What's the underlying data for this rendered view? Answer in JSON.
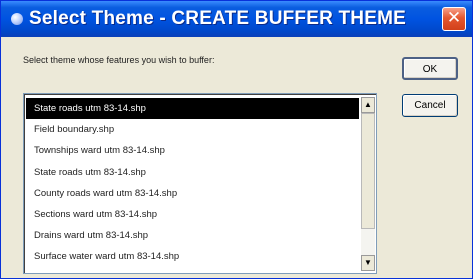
{
  "window": {
    "title": "Select Theme - CREATE BUFFER THEME",
    "close_glyph": "✕",
    "close_icon": "close-icon",
    "title_icon": "globe-icon"
  },
  "dialog": {
    "prompt": "Select theme whose features you wish to buffer:",
    "ok_label": "OK",
    "cancel_label": "Cancel"
  },
  "themes": {
    "selected_index": 0,
    "items": [
      "State roads utm 83-14.shp",
      "Field boundary.shp",
      "Townships ward utm 83-14.shp",
      "State roads utm 83-14.shp",
      "County roads ward utm 83-14.shp",
      "Sections ward utm 83-14.shp",
      "Drains ward utm 83-14.shp",
      "Surface water ward utm 83-14.shp"
    ]
  },
  "scrollbar": {
    "up_glyph": "▲",
    "down_glyph": "▼",
    "position": 0.0,
    "visible_fraction": 0.82
  },
  "colors": {
    "titlebar": "#0053e1",
    "selection": "#000000",
    "close": "#e4572f"
  }
}
